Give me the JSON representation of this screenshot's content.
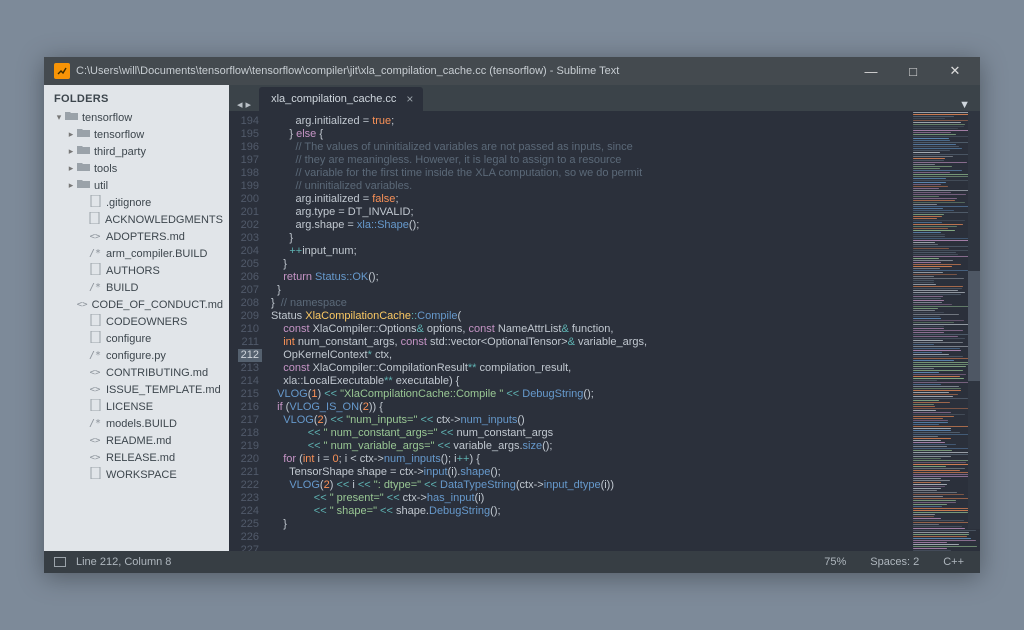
{
  "title": "C:\\Users\\will\\Documents\\tensorflow\\tensorflow\\compiler\\jit\\xla_compilation_cache.cc (tensorflow) - Sublime Text",
  "window_controls": {
    "minimize": "—",
    "maximize": "□",
    "close": "✕"
  },
  "sidebar": {
    "title": "FOLDERS",
    "tree": [
      {
        "depth": 0,
        "chev": "▾",
        "icon": "folder",
        "label": "tensorflow"
      },
      {
        "depth": 1,
        "chev": "▸",
        "icon": "folder",
        "label": "tensorflow"
      },
      {
        "depth": 1,
        "chev": "▸",
        "icon": "folder",
        "label": "third_party"
      },
      {
        "depth": 1,
        "chev": "▸",
        "icon": "folder",
        "label": "tools"
      },
      {
        "depth": 1,
        "chev": "▸",
        "icon": "folder",
        "label": "util"
      },
      {
        "depth": 2,
        "chev": "",
        "icon": "file",
        "label": ".gitignore"
      },
      {
        "depth": 2,
        "chev": "",
        "icon": "file",
        "label": "ACKNOWLEDGMENTS"
      },
      {
        "depth": 2,
        "chev": "",
        "icon": "md",
        "label": "ADOPTERS.md"
      },
      {
        "depth": 2,
        "chev": "",
        "icon": "code",
        "label": "arm_compiler.BUILD"
      },
      {
        "depth": 2,
        "chev": "",
        "icon": "file",
        "label": "AUTHORS"
      },
      {
        "depth": 2,
        "chev": "",
        "icon": "code",
        "label": "BUILD"
      },
      {
        "depth": 2,
        "chev": "",
        "icon": "md",
        "label": "CODE_OF_CONDUCT.md"
      },
      {
        "depth": 2,
        "chev": "",
        "icon": "file",
        "label": "CODEOWNERS"
      },
      {
        "depth": 2,
        "chev": "",
        "icon": "file",
        "label": "configure"
      },
      {
        "depth": 2,
        "chev": "",
        "icon": "code",
        "label": "configure.py"
      },
      {
        "depth": 2,
        "chev": "",
        "icon": "md",
        "label": "CONTRIBUTING.md"
      },
      {
        "depth": 2,
        "chev": "",
        "icon": "md",
        "label": "ISSUE_TEMPLATE.md"
      },
      {
        "depth": 2,
        "chev": "",
        "icon": "file",
        "label": "LICENSE"
      },
      {
        "depth": 2,
        "chev": "",
        "icon": "code",
        "label": "models.BUILD"
      },
      {
        "depth": 2,
        "chev": "",
        "icon": "md",
        "label": "README.md"
      },
      {
        "depth": 2,
        "chev": "",
        "icon": "md",
        "label": "RELEASE.md"
      },
      {
        "depth": 2,
        "chev": "",
        "icon": "file",
        "label": "WORKSPACE"
      }
    ]
  },
  "tabs": {
    "nav_back": "◂",
    "nav_fwd": "▸",
    "items": [
      {
        "label": "xla_compilation_cache.cc",
        "close": "×"
      }
    ],
    "dropdown": "▼"
  },
  "code": {
    "first_line": 194,
    "highlight_line": 212,
    "lines": [
      "        arg.initialized = <span class='t'>true</span>;",
      "      } <span class='kw'>else</span> {",
      "        <span class='c'>// The values of uninitialized variables are not passed as inputs, since</span>",
      "        <span class='c'>// they are meaningless. However, it is legal to assign to a resource</span>",
      "        <span class='c'>// variable for the first time inside the XLA computation, so we do permit</span>",
      "        <span class='c'>// uninitialized variables.</span>",
      "        arg.initialized = <span class='t'>false</span>;",
      "        arg.type = DT_INVALID;",
      "        arg.shape = <span class='fn'>xla::Shape</span>();",
      "      }",
      "      <span class='op'>++</span>input_num;",
      "    }",
      "",
      "    <span class='kw'>return</span> <span class='fn'>Status::OK</span>();",
      "  }",
      "",
      "}  <span class='c'>// namespace</span>",
      "",
      "Status <span class='n'>XlaCompilationCache</span><span class='op'>::</span><span class='fn'>Compile</span>(",
      "    <span class='kw'>const</span> XlaCompiler::Options<span class='op'>&</span> options, <span class='kw'>const</span> NameAttrList<span class='op'>&</span> function,",
      "    <span class='t'>int</span> num_constant_args, <span class='kw'>const</span> std::vector&lt;OptionalTensor&gt;<span class='op'>&</span> variable_args,",
      "    OpKernelContext<span class='op'>*</span> ctx,",
      "    <span class='kw'>const</span> XlaCompiler::CompilationResult<span class='op'>**</span> compilation_result,",
      "    xla::LocalExecutable<span class='op'>**</span> executable) {",
      "  <span class='fn'>VLOG</span>(<span class='t'>1</span>) <span class='op'>&lt;&lt;</span> <span class='s'>\"XlaCompilationCache::Compile \"</span> <span class='op'>&lt;&lt;</span> <span class='fn'>DebugString</span>();",
      "",
      "  <span class='kw'>if</span> (<span class='fn'>VLOG_IS_ON</span>(<span class='t'>2</span>)) {",
      "    <span class='fn'>VLOG</span>(<span class='t'>2</span>) <span class='op'>&lt;&lt;</span> <span class='s'>\"num_inputs=\"</span> <span class='op'>&lt;&lt;</span> ctx-&gt;<span class='fn'>num_inputs</span>()",
      "            <span class='op'>&lt;&lt;</span> <span class='s'>\" num_constant_args=\"</span> <span class='op'>&lt;&lt;</span> num_constant_args",
      "            <span class='op'>&lt;&lt;</span> <span class='s'>\" num_variable_args=\"</span> <span class='op'>&lt;&lt;</span> variable_args.<span class='fn'>size</span>();",
      "    <span class='kw'>for</span> (<span class='t'>int</span> i = <span class='t'>0</span>; i &lt; ctx-&gt;<span class='fn'>num_inputs</span>(); i<span class='op'>++</span>) {",
      "      TensorShape shape = ctx-&gt;<span class='fn'>input</span>(i).<span class='fn'>shape</span>();",
      "      <span class='fn'>VLOG</span>(<span class='t'>2</span>) <span class='op'>&lt;&lt;</span> i <span class='op'>&lt;&lt;</span> <span class='s'>\": dtype=\"</span> <span class='op'>&lt;&lt;</span> <span class='fn'>DataTypeString</span>(ctx-&gt;<span class='fn'>input_dtype</span>(i))",
      "              <span class='op'>&lt;&lt;</span> <span class='s'>\" present=\"</span> <span class='op'>&lt;&lt;</span> ctx-&gt;<span class='fn'>has_input</span>(i)",
      "              <span class='op'>&lt;&lt;</span> <span class='s'>\" shape=\"</span> <span class='op'>&lt;&lt;</span> shape.<span class='fn'>DebugString</span>();",
      "    }"
    ]
  },
  "status": {
    "cursor": "Line 212, Column 8",
    "zoom": "75%",
    "spaces": "Spaces: 2",
    "lang": "C++"
  }
}
